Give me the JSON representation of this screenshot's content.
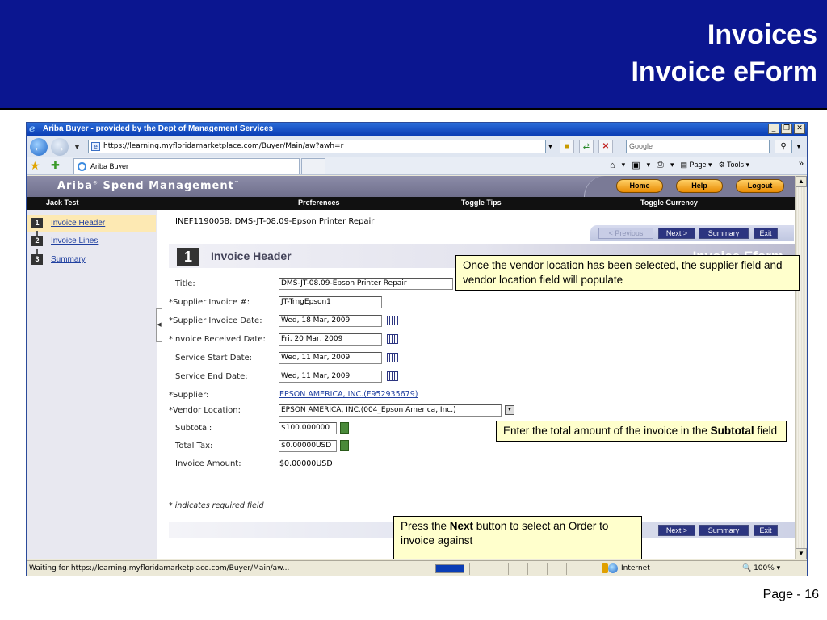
{
  "slide": {
    "title_line1": "Invoices",
    "title_line2": "Invoice eForm",
    "page_number": "Page - 16"
  },
  "browser": {
    "window_title": "Ariba Buyer - provided by the Dept of Management Services",
    "window_buttons": [
      "_",
      "❐",
      "✕"
    ],
    "url": "https://learning.myfloridamarketplace.com/Buyer/Main/aw?awh=r",
    "search_placeholder": "Google",
    "tab_label": "Ariba Buyer",
    "commands": {
      "page": "Page",
      "tools": "Tools"
    },
    "status_text": "Waiting for https://learning.myfloridamarketplace.com/Buyer/Main/aw...",
    "zone": "Internet",
    "zoom": "100%"
  },
  "ariba": {
    "logo": "Ariba",
    "logo_rest": "Spend Management",
    "buttons": {
      "home": "Home",
      "help": "Help",
      "logout": "Logout"
    },
    "user": "Jack Test",
    "nav": {
      "preferences": "Preferences",
      "toggle_tips": "Toggle Tips",
      "toggle_currency": "Toggle Currency"
    },
    "steps": [
      {
        "num": "1",
        "label": "Invoice Header"
      },
      {
        "num": "2",
        "label": "Invoice Lines"
      },
      {
        "num": "3",
        "label": "Summary"
      }
    ],
    "doc_title": "INEF1190058: DMS-JT-08.09-Epson Printer Repair",
    "actions": {
      "previous": "< Previous",
      "next": "Next >",
      "summary": "Summary",
      "exit": "Exit"
    },
    "section": {
      "num": "1",
      "title": "Invoice Header",
      "right": "Invoice Eform"
    },
    "fields": {
      "title_label": "Title:",
      "title_value": "DMS-JT-08.09-Epson Printer Repair",
      "supplier_invoice_label": "*Supplier Invoice #:",
      "supplier_invoice_value": "JT-TrngEpson1",
      "supplier_invoice_date_label": "*Supplier Invoice Date:",
      "supplier_invoice_date_value": "Wed, 18 Mar, 2009",
      "invoice_received_label": "*Invoice Received Date:",
      "invoice_received_value": "Fri, 20 Mar, 2009",
      "service_start_label": "Service Start Date:",
      "service_start_value": "Wed, 11 Mar, 2009",
      "service_end_label": "Service End Date:",
      "service_end_value": "Wed, 11 Mar, 2009",
      "supplier_label": "*Supplier:",
      "supplier_value": "EPSON AMERICA, INC.(F952935679)",
      "vendor_location_label": "*Vendor Location:",
      "vendor_location_value": "EPSON AMERICA, INC.(004_Epson America, Inc.)",
      "subtotal_label": "Subtotal:",
      "subtotal_value": "$100.000000",
      "total_tax_label": "Total Tax:",
      "total_tax_value": "$0.00000USD",
      "invoice_amount_label": "Invoice Amount:",
      "invoice_amount_value": "$0.00000USD"
    },
    "required_note": "* indicates required field"
  },
  "callouts": {
    "c1": "Once the vendor location has been selected, the supplier field and vendor location field will populate",
    "c2_pre": "Enter the total amount of the invoice in the ",
    "c2_bold": "Subtotal",
    "c2_post": " field",
    "c3_pre": "Press the ",
    "c3_bold": "Next",
    "c3_post": " button to select an Order to invoice against"
  }
}
